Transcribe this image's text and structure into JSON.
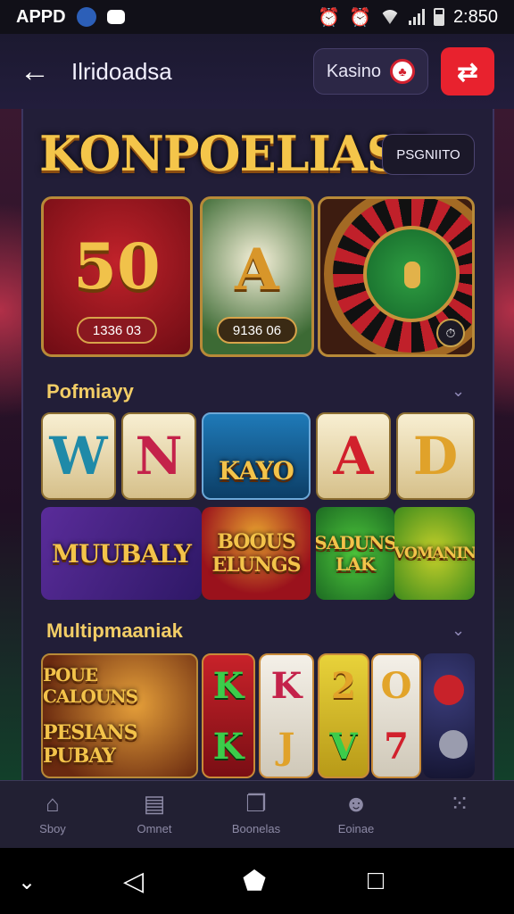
{
  "status": {
    "left_text": "APPD",
    "time": "2:850"
  },
  "appbar": {
    "back_icon": "arrow-left-icon",
    "title": "Ilridoadsa",
    "kasino_label": "Kasino",
    "kasino_icon": "casino-chip-icon",
    "share_icon": "share-icon",
    "accent": "#e8222e"
  },
  "hero": {
    "logo": "KONPOELIAS5",
    "chip_label": "PSGNIITO",
    "cards": [
      {
        "value": "50",
        "pill": "1336 03"
      },
      {
        "value": "A",
        "pill": "9136 06"
      },
      {
        "value": "",
        "pill": ""
      }
    ]
  },
  "section1": {
    "title": "Pofmiayy",
    "tiles": [
      "W",
      "N",
      "KAYO",
      "A",
      "D"
    ],
    "banners": [
      "MUUBALY",
      "BOOUS ELUNGS",
      "SADUNS LAK",
      "VOMANIN"
    ]
  },
  "section2": {
    "title": "Multipmaaniak",
    "tiles": [
      "POUE CALOUNS",
      "PESIANS PUBAY",
      "K",
      "K",
      "2",
      "O",
      "K",
      "J",
      "V",
      "7"
    ]
  },
  "bottom_nav": [
    {
      "label": "Sboy",
      "icon": "home-icon"
    },
    {
      "label": "Omnet",
      "icon": "wallet-icon"
    },
    {
      "label": "Boonelas",
      "icon": "gift-icon"
    },
    {
      "label": "Eoinae",
      "icon": "profile-icon"
    },
    {
      "label": "",
      "icon": "more-icon"
    }
  ]
}
